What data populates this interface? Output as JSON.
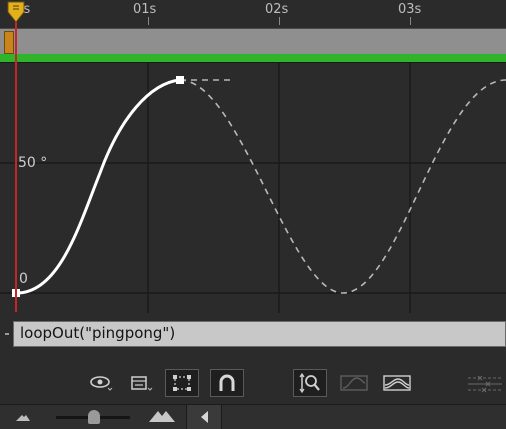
{
  "ruler": {
    "labels": [
      "00s",
      "01s",
      "02s",
      "03s"
    ]
  },
  "graph": {
    "value_label_mid": "50 °",
    "value_label_zero": "0"
  },
  "expression": {
    "text": "loopOut(\"pingpong\")"
  },
  "toolbar": {
    "icons": [
      "eye-icon",
      "graph-type-icon",
      "transform-box-icon",
      "snap-magnet-icon",
      "fit-zoom-icon",
      "fit-selection-icon",
      "fit-all-icon",
      "separate-dimensions-icon"
    ]
  },
  "bottom": {
    "icons": [
      "zoom-out-mountain-icon",
      "zoom-slider",
      "zoom-in-mountain-icon",
      "scroll-left-arrow-icon"
    ]
  },
  "colors": {
    "playhead": "#c8242a",
    "work_area_bar": "#2fb52c",
    "curve": "#ffffff"
  }
}
